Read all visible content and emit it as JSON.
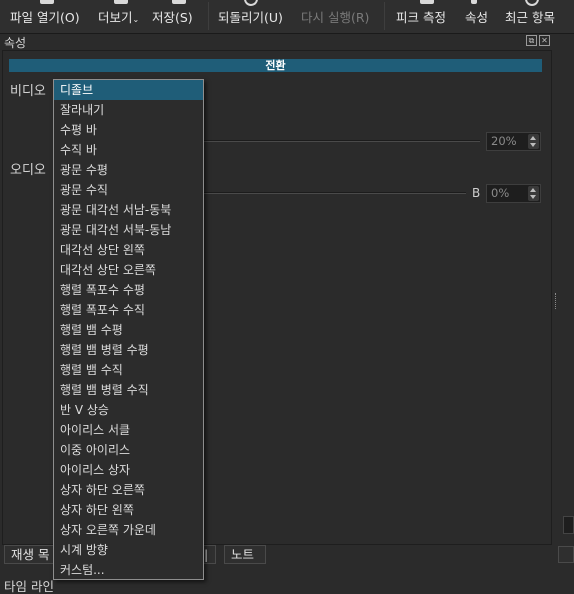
{
  "toolbar": {
    "items": [
      {
        "label": "파일 열기(O)",
        "disabled": false
      },
      {
        "label": "더보기",
        "disabled": false
      },
      {
        "label": "저장(S)",
        "disabled": false
      },
      {
        "label": "되돌리기(U)",
        "disabled": false
      },
      {
        "label": "다시 실행(R)",
        "disabled": true
      },
      {
        "label": "피크 측정",
        "disabled": false
      },
      {
        "label": "속성",
        "disabled": false
      },
      {
        "label": "최근 항목",
        "disabled": false
      }
    ]
  },
  "panel": {
    "title": "속성",
    "section_header": "전환",
    "video_label": "비디오",
    "audio_label": "오디오",
    "video_spin_value": "20%",
    "audio_b_label": "B",
    "audio_spin_value": "0%"
  },
  "bottom_tabs": {
    "playlist": "재생 목",
    "notes": "노트",
    "partial": "|"
  },
  "timeline_label": "타임 라인",
  "dropdown": {
    "selected_index": 0,
    "items": [
      "디졸브",
      "잘라내기",
      "수평 바",
      "수직 바",
      "광문 수평",
      "광문 수직",
      "광문 대각선 서남-동북",
      "광문 대각선 서북-동남",
      "대각선 상단 왼쪽",
      "대각선 상단 오른쪽",
      "행렬 폭포수 수평",
      "행렬 폭포수 수직",
      "행렬 뱀 수평",
      "행렬 뱀 병렬 수평",
      "행렬 뱀 수직",
      "행렬 뱀 병렬 수직",
      "반 V 상승",
      "아이리스 서클",
      "이중 아이리스",
      "아이리스 상자",
      "상자 하단 오른쪽",
      "상자 하단 왼쪽",
      "상자 오른쪽 가운데",
      "시계 방향",
      "커스텀..."
    ]
  }
}
